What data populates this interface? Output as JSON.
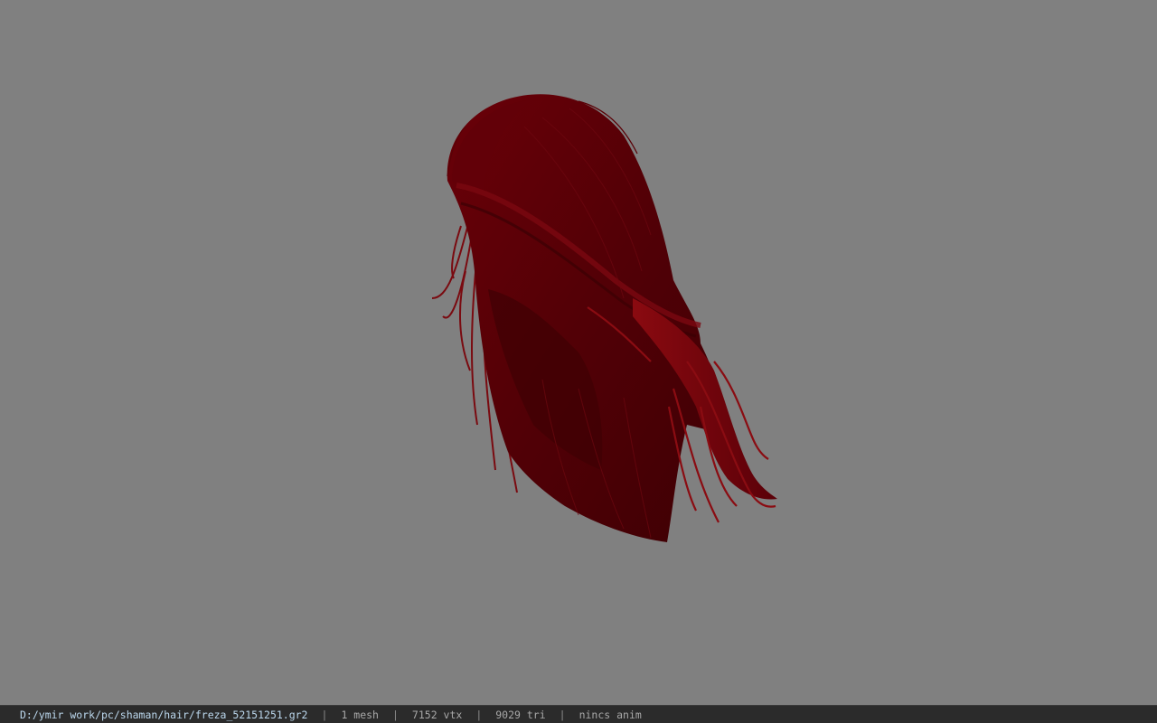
{
  "viewer": {
    "background_color": "#808080",
    "model_color": "#5a0006",
    "model_highlight_color": "#8a0c12",
    "model_shadow_color": "#3a0004"
  },
  "status_bar": {
    "file_path": "D:/ymir work/pc/shaman/hair/freza_52151251.gr2",
    "separator": "|",
    "mesh_count": "1 mesh",
    "vertex_count": "7152 vtx",
    "triangle_count": "9029 tri",
    "anim_label": "nincs anim"
  }
}
